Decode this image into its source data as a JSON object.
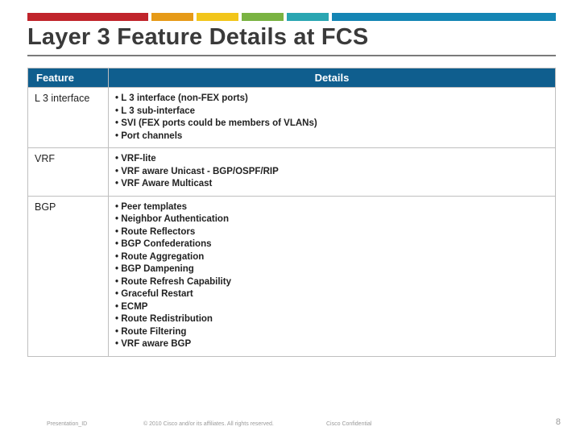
{
  "title": "Layer 3 Feature Details at FCS",
  "header": {
    "feature": "Feature",
    "details": "Details"
  },
  "rows": [
    {
      "name": "L 3 interface",
      "items": [
        "L 3 interface (non-FEX ports)",
        "L 3 sub-interface",
        "SVI (FEX ports could be members of VLANs)",
        "Port channels"
      ]
    },
    {
      "name": "VRF",
      "items": [
        "VRF-lite",
        "VRF aware Unicast - BGP/OSPF/RIP",
        "VRF Aware Multicast"
      ]
    },
    {
      "name": "BGP",
      "items": [
        "Peer templates",
        "Neighbor Authentication",
        "Route Reflectors",
        "BGP Confederations",
        "Route Aggregation",
        "BGP Dampening",
        "Route Refresh Capability",
        "Graceful Restart",
        "ECMP",
        "Route Redistribution",
        "Route Filtering",
        "VRF aware BGP"
      ]
    }
  ],
  "footer": {
    "presentation_id": "Presentation_ID",
    "copyright": "© 2010 Cisco and/or its affiliates. All rights reserved.",
    "confidential": "Cisco Confidential",
    "page": "8"
  }
}
